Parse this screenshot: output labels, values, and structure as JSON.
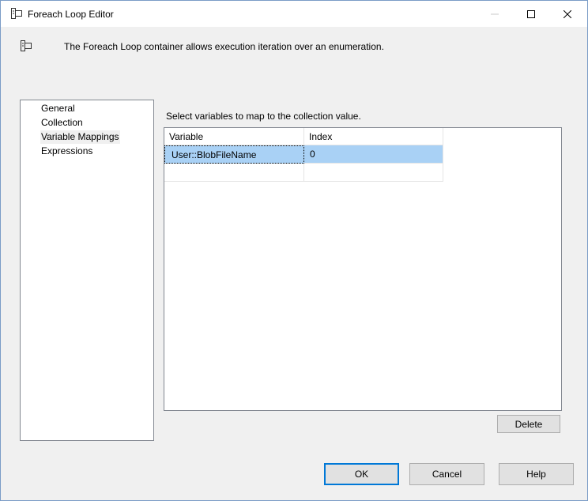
{
  "window": {
    "title": "Foreach Loop Editor"
  },
  "header": {
    "description": "The Foreach Loop container allows execution iteration over an enumeration."
  },
  "nav": {
    "items": [
      {
        "label": "General",
        "selected": false
      },
      {
        "label": "Collection",
        "selected": false
      },
      {
        "label": "Variable Mappings",
        "selected": true
      },
      {
        "label": "Expressions",
        "selected": false
      }
    ]
  },
  "mappings": {
    "instruction": "Select variables to map to the collection value.",
    "columns": [
      "Variable",
      "Index"
    ],
    "rows": [
      {
        "variable": "User::BlobFileName",
        "index": "0"
      },
      {
        "variable": "",
        "index": ""
      }
    ]
  },
  "buttons": {
    "delete": "Delete",
    "ok": "OK",
    "cancel": "Cancel",
    "help": "Help"
  },
  "colors": {
    "selection": "#a9d1f5",
    "default_button_border": "#0078d7"
  }
}
